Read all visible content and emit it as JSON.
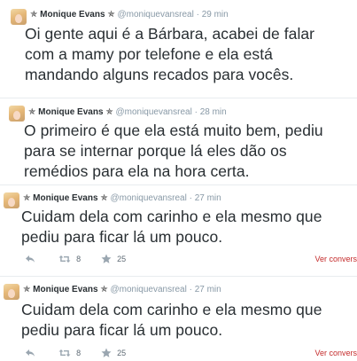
{
  "tweets": [
    {
      "name": "Monique Evans",
      "handle": "@moniquevansreal",
      "time": "29 min",
      "text_lines": [
        "Oi gente aqui é a Bárbara, acabei de falar",
        "com a mamy por telefone e ela está",
        "mandando alguns recados para vocês."
      ]
    },
    {
      "name": "Monique Evans",
      "handle": "@moniquevansreal",
      "time": "28 min",
      "text_lines": [
        "O primeiro é que ela está muito bem, pediu",
        "para se internar porque lá eles dão os",
        "remédios para ela na hora certa."
      ]
    },
    {
      "name": "Monique Evans",
      "handle": "@moniquevansreal",
      "time": "27 min",
      "text_lines": [
        "Cuidam dela com carinho e ela mesmo que",
        "pediu para ficar lá um pouco."
      ],
      "actions": {
        "retweets": "8",
        "favorites": "25",
        "view_conversation": "Ver convers"
      }
    },
    {
      "name": "Monique Evans",
      "handle": "@moniquevansreal",
      "time": "27 min",
      "text_lines": [
        "Cuidam dela com carinho e ela mesmo que",
        "pediu para ficar lá um pouco."
      ],
      "actions": {
        "retweets": "8",
        "favorites": "25",
        "view_conversation": "Ver convers"
      }
    }
  ],
  "icons": {
    "star_glyph": "✯",
    "reply": "reply-icon",
    "retweet": "retweet-icon",
    "favorite": "favorite-star-icon"
  },
  "colors": {
    "name": "#292f33",
    "meta": "#8899a6",
    "link_red": "#c42b2b",
    "action_gray": "#9aa6b0"
  }
}
